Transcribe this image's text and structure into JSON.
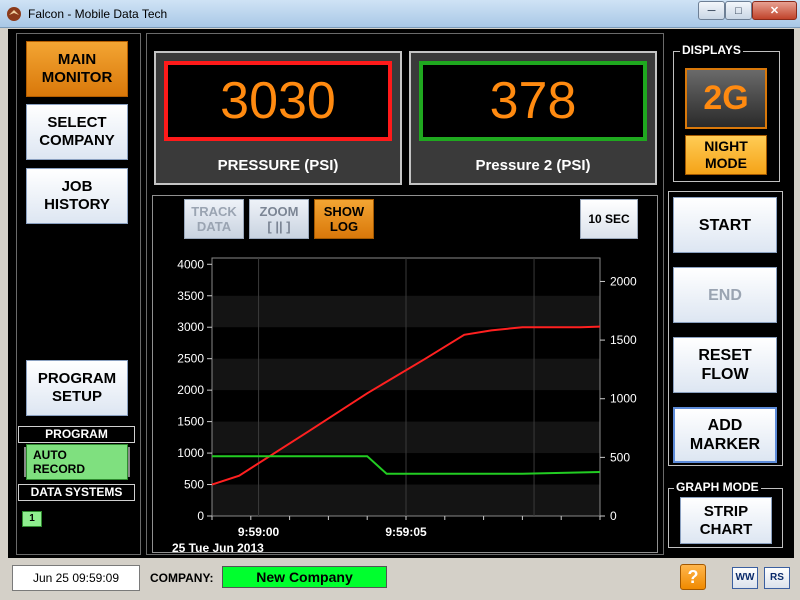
{
  "window": {
    "title": "Falcon - Mobile Data Tech"
  },
  "nav": {
    "main_monitor": "MAIN\nMONITOR",
    "select_company": "SELECT\nCOMPANY",
    "job_history": "JOB\nHISTORY",
    "program_setup": "PROGRAM\nSETUP"
  },
  "program": {
    "label": "PROGRAM",
    "auto_record": "AUTO RECORD"
  },
  "data_systems": {
    "label": "DATA SYSTEMS",
    "chip": "1"
  },
  "gauges": [
    {
      "value": "3030",
      "label": "PRESSURE (PSI)",
      "border_color": "#ff1a1a"
    },
    {
      "value": "378",
      "label": "Pressure 2 (PSI)",
      "border_color": "#1fa81f"
    }
  ],
  "chart_buttons": {
    "track_data": "TRACK\nDATA",
    "zoom": "ZOOM\n[ || ]",
    "show_log": "SHOW\nLOG",
    "interval": "10 SEC"
  },
  "displays": {
    "title": "DISPLAYS",
    "mode": "2G",
    "night_mode": "NIGHT\nMODE"
  },
  "controls": {
    "start": "START",
    "end": "END",
    "reset_flow": "RESET\nFLOW",
    "add_marker": "ADD\nMARKER"
  },
  "graph_mode": {
    "title": "GRAPH MODE",
    "strip_chart": "STRIP\nCHART"
  },
  "status": {
    "datetime": "Jun 25 09:59:09",
    "company_label": "COMPANY:",
    "company_value": "New Company",
    "help": "?",
    "ww": "WW",
    "rs": "RS"
  },
  "chart_data": {
    "type": "line",
    "x_tick_labels": [
      "9:59:00",
      "9:59:05"
    ],
    "date_label": "25 Tue   Jun 2013",
    "y_left": {
      "ticks": [
        0,
        500,
        1000,
        1500,
        2000,
        2500,
        3000,
        3500,
        4000
      ],
      "ylim": [
        0,
        4100
      ]
    },
    "y_right": {
      "ticks": [
        0,
        500,
        1000,
        1500,
        2000
      ],
      "ylim": [
        0,
        2200
      ]
    },
    "grid": true,
    "series": [
      {
        "axis": "left",
        "color": "#ff2020",
        "x": [
          0,
          0.07,
          0.25,
          0.4,
          0.55,
          0.65,
          0.72,
          0.8,
          0.88,
          0.95,
          1.0
        ],
        "values": [
          500,
          640,
          1350,
          1950,
          2500,
          2880,
          2950,
          3000,
          3000,
          3000,
          3010
        ]
      },
      {
        "axis": "right",
        "color": "#22cc22",
        "x": [
          0,
          0.35,
          0.4,
          0.45,
          0.6,
          0.8,
          1.0
        ],
        "values": [
          510,
          510,
          510,
          360,
          360,
          360,
          375
        ]
      }
    ]
  },
  "colors": {
    "accent_orange": "#ff8a10",
    "company_green": "#00ff2e"
  }
}
